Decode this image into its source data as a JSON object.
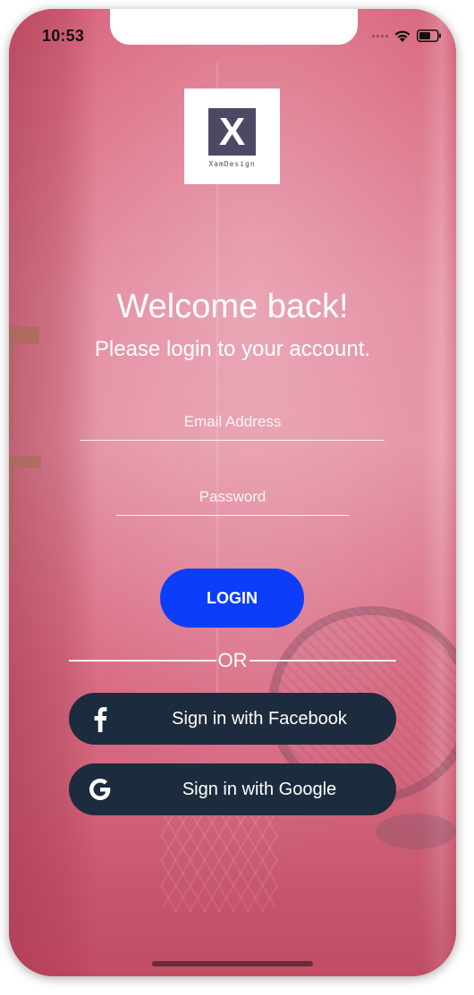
{
  "status_bar": {
    "time": "10:53"
  },
  "logo": {
    "mark": "X",
    "text": "XamDesign"
  },
  "heading": {
    "title": "Welcome back!",
    "subtitle": "Please login to your account."
  },
  "form": {
    "email_placeholder": "Email Address",
    "password_placeholder": "Password",
    "login_label": "LOGIN"
  },
  "divider": {
    "label": "OR"
  },
  "social": {
    "facebook_label": "Sign in with Facebook",
    "facebook_icon": "facebook-icon",
    "google_label": "Sign in with Google",
    "google_icon": "google-icon"
  },
  "colors": {
    "login_button": "#0b3dfa",
    "social_button": "#1c2b3d",
    "logo_mark": "#4f4865",
    "background": "#d9677f"
  }
}
